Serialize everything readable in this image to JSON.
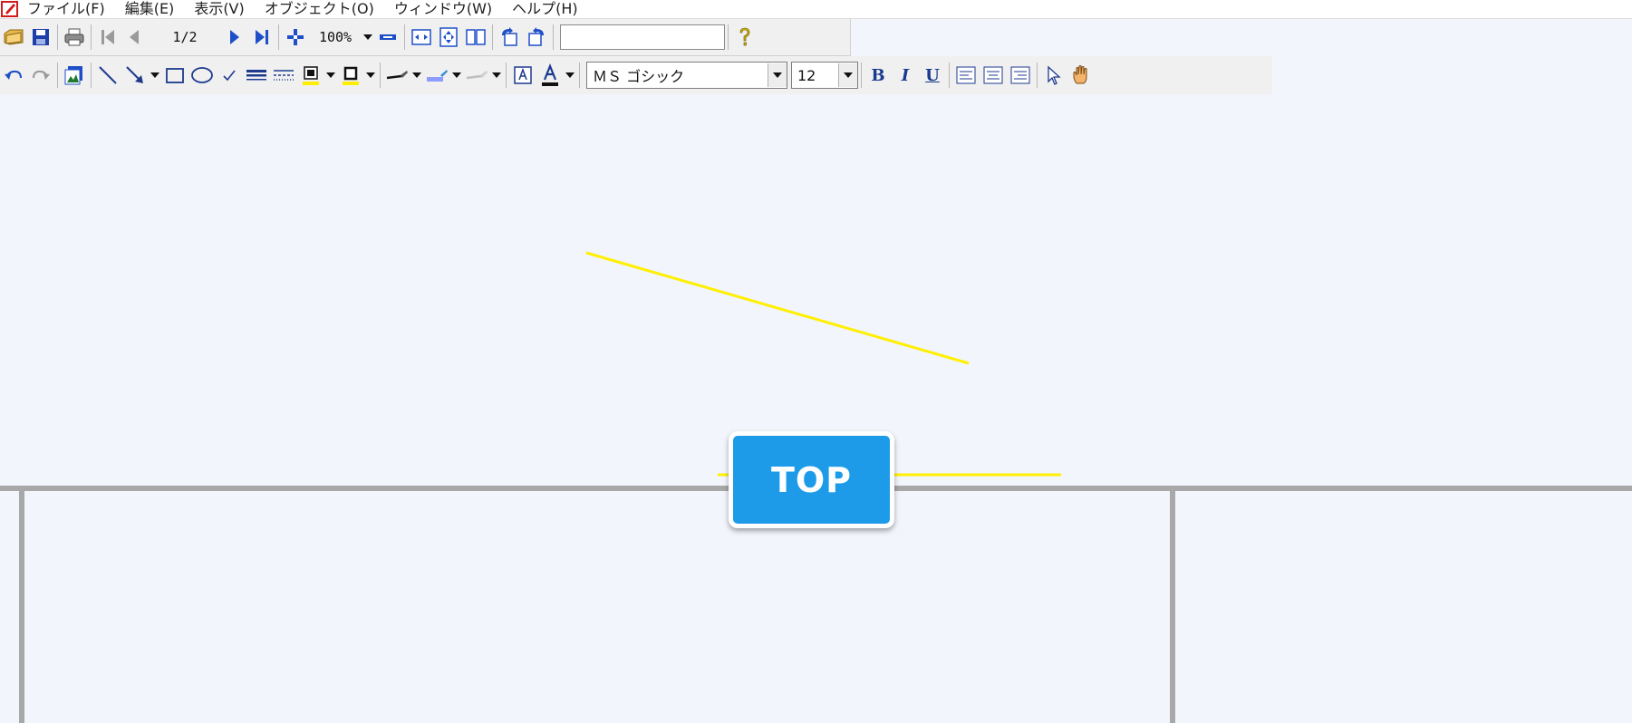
{
  "menu": {
    "items": [
      "ファイル(F)",
      "編集(E)",
      "表示(V)",
      "オブジェクト(O)",
      "ウィンドウ(W)",
      "ヘルプ(H)"
    ]
  },
  "toolbar1": {
    "page_indicator": "1/2",
    "zoom": "100%",
    "text_box_value": ""
  },
  "toolbar2": {
    "font_name": "ＭＳ ゴシック",
    "font_size": "12",
    "bold_label": "B",
    "italic_label": "I",
    "underline_label": "U"
  },
  "canvas": {
    "button_label": "TOP"
  },
  "colors": {
    "canvas_bg": "#f2f5fc",
    "button_blue": "#1e9be8",
    "annotation_yellow": "#ffef00",
    "connector_gray": "#a8a8a8",
    "toolbar_bg": "#f0f0f0"
  },
  "icons": [
    "app-icon",
    "open-icon",
    "save-icon",
    "print-icon",
    "first-page-icon",
    "prev-page-icon",
    "next-page-icon",
    "last-page-icon",
    "zoom-in-icon",
    "zoom-out-icon",
    "fit-width-icon",
    "fit-page-icon",
    "two-page-icon",
    "rotate-left-icon",
    "rotate-right-icon",
    "help-icon",
    "undo-icon",
    "redo-icon",
    "insert-image-icon",
    "line-icon",
    "arrow-icon",
    "rectangle-icon",
    "ellipse-icon",
    "check-icon",
    "line-thickness-icon",
    "line-style-icon",
    "fill-color-icon",
    "border-color-icon",
    "pen-icon",
    "highlighter-icon",
    "eraser-icon",
    "text-box-icon",
    "font-color-icon",
    "align-left-icon",
    "align-center-icon",
    "align-right-icon",
    "select-pointer-icon",
    "hand-tool-icon"
  ]
}
